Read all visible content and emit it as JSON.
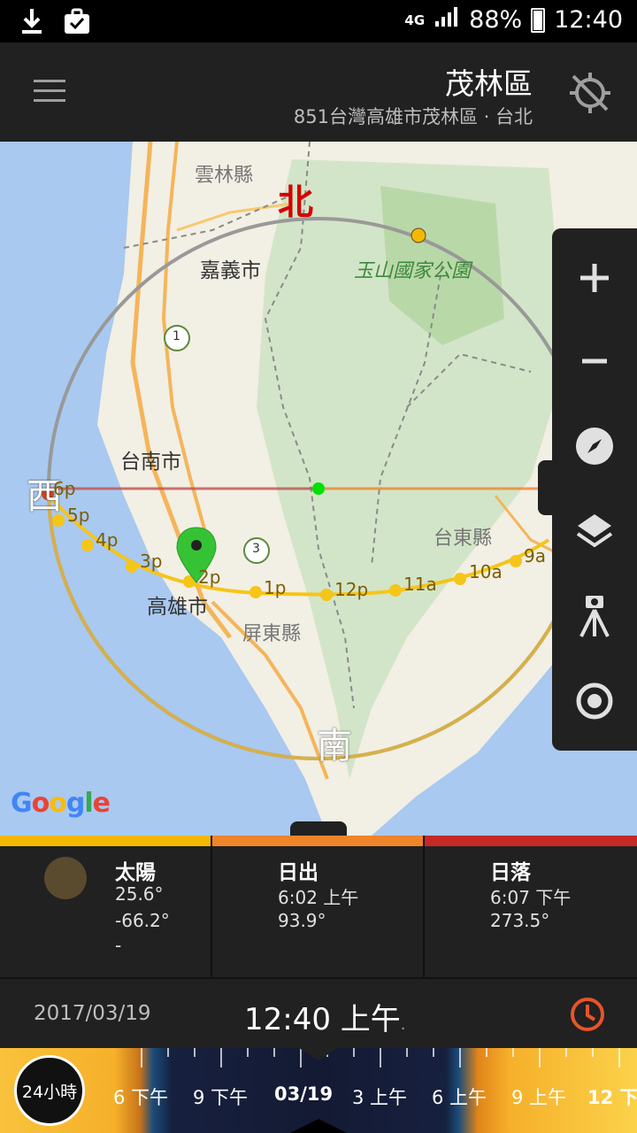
{
  "status_bar": {
    "network": "4G",
    "battery": "88%",
    "time": "12:40"
  },
  "header": {
    "title": "茂林區",
    "subtitle": "851台灣高雄市茂林區 · 台北"
  },
  "map": {
    "places": {
      "yunlin": "雲林縣",
      "chiayi": "嘉義市",
      "tainan": "台南市",
      "kaohsiung": "高雄市",
      "pingtung": "屏東縣",
      "taitung": "台東縣",
      "park": "玉山國家公園"
    },
    "route_badges": {
      "r1": "1",
      "r3": "3"
    },
    "directions": {
      "north": "北",
      "south": "南",
      "west": "西"
    },
    "sun_hours": [
      "6p",
      "5p",
      "4p",
      "3p",
      "2p",
      "1p",
      "12p",
      "11a",
      "10a",
      "9a"
    ],
    "google_logo": [
      "G",
      "o",
      "o",
      "g",
      "l",
      "e"
    ]
  },
  "side_controls": [
    "zoom-in-icon",
    "zoom-out-icon",
    "compass-icon",
    "layers-icon",
    "tripod-icon",
    "target-icon"
  ],
  "info": {
    "sun": {
      "title": "太陽",
      "elevation": "25.6°",
      "azimuth": "-66.2°",
      "extra": "-"
    },
    "sunrise": {
      "title": "日出",
      "time": "6:02 上午",
      "azimuth": "93.9°"
    },
    "sunset": {
      "title": "日落",
      "time": "6:07 下午",
      "azimuth": "273.5°"
    }
  },
  "time_row": {
    "date": "2017/03/19",
    "time": "12:40 上午",
    "dot": "."
  },
  "timeline": {
    "button": "24小時",
    "labels": [
      "6 下午",
      "9 下午",
      "03/19",
      "3 上午",
      "6 上午",
      "9 上午",
      "12 下"
    ]
  },
  "colors": {
    "sun_path": "#f5c518",
    "sunrise_bar": "#f0842a",
    "sunset_bar": "#c62828",
    "sun_bar": "#f5b800",
    "north_label": "#d50000",
    "accent_clock": "#e6542a"
  }
}
